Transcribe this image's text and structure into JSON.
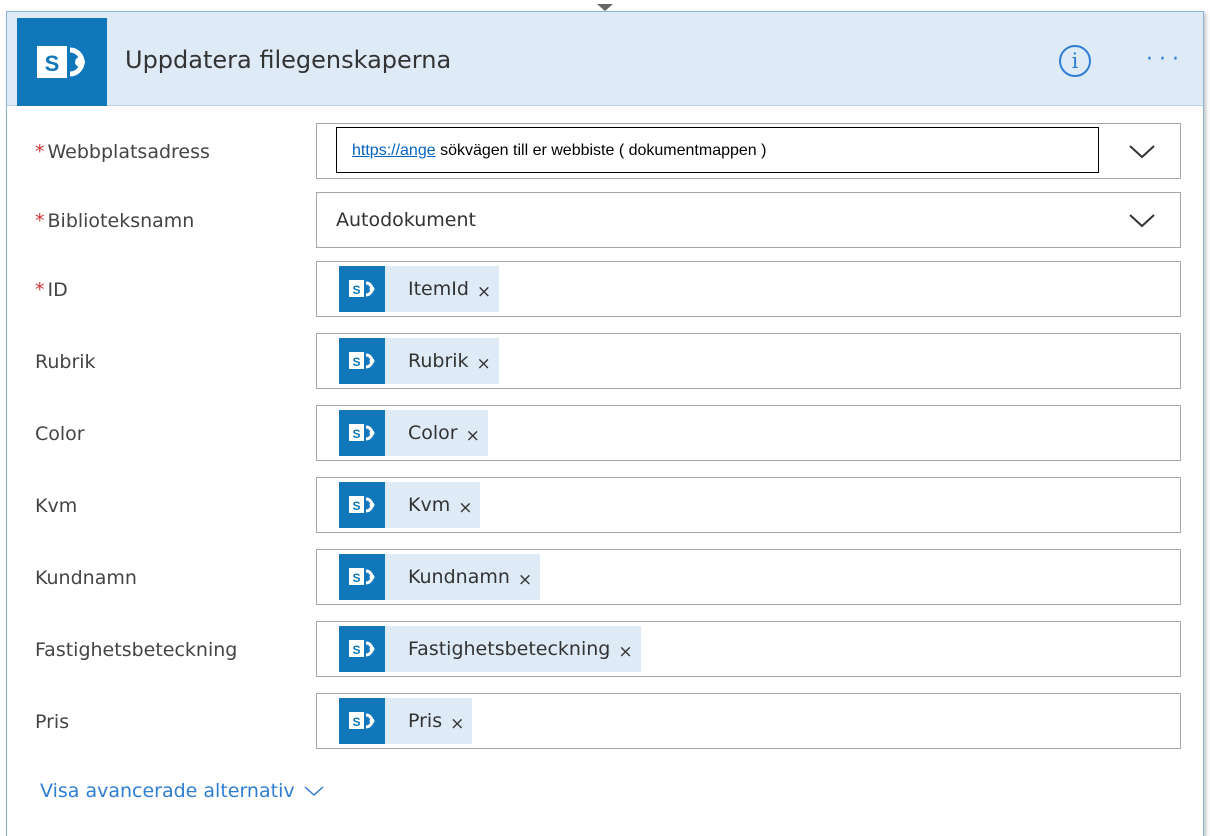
{
  "header": {
    "title": "Uppdatera filegenskaperna",
    "info_glyph": "i",
    "more_glyph": "···",
    "accent_color": "#0f77ba",
    "link_color": "#2f7ed4"
  },
  "fields": {
    "site_address": {
      "label": "Webbplatsadress",
      "required_mark": "*",
      "link_text": "https://ange",
      "rest_text": " sökvägen till er webbiste ( dokumentmappen )"
    },
    "library": {
      "label": "Biblioteksnamn",
      "required_mark": "*",
      "value": "Autodokument"
    },
    "id": {
      "label": "ID",
      "required_mark": "*",
      "token": "ItemId"
    },
    "rubrik": {
      "label": "Rubrik",
      "token": "Rubrik"
    },
    "color": {
      "label": "Color",
      "token": "Color"
    },
    "kvm": {
      "label": "Kvm",
      "token": "Kvm"
    },
    "kundnamn": {
      "label": "Kundnamn",
      "token": "Kundnamn"
    },
    "fastighet": {
      "label": "Fastighetsbeteckning",
      "token": "Fastighetsbeteckning"
    },
    "pris": {
      "label": "Pris",
      "token": "Pris"
    }
  },
  "token_remove_glyph": "×",
  "advanced_link": "Visa avancerade alternativ"
}
